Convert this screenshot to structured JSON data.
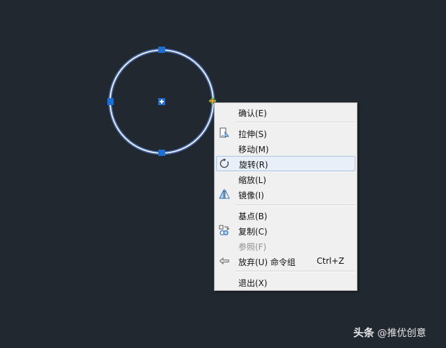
{
  "canvas": {
    "background": "#212830",
    "entity": "circle",
    "grip_color": "#1e6fd1",
    "hot_grip_color": "#2ea04a"
  },
  "context_menu": {
    "items": [
      {
        "label": "确认(E)",
        "icon": null
      },
      {
        "label": "拉伸(S)",
        "icon": "stretch-icon"
      },
      {
        "label": "移动(M)",
        "icon": null
      },
      {
        "label": "旋转(R)",
        "icon": "rotate-icon",
        "highlighted": true
      },
      {
        "label": "缩放(L)",
        "icon": null
      },
      {
        "label": "镜像(I)",
        "icon": "mirror-icon"
      },
      {
        "label": "基点(B)",
        "icon": null
      },
      {
        "label": "复制(C)",
        "icon": "copy-icon"
      },
      {
        "label": "参照(F)",
        "icon": null,
        "disabled": true
      },
      {
        "label": "放弃(U) 命令组",
        "icon": "undo-icon",
        "shortcut": "Ctrl+Z"
      },
      {
        "label": "退出(X)",
        "icon": null
      }
    ]
  },
  "watermark": {
    "brand": "头条",
    "text": "@推优创意"
  }
}
